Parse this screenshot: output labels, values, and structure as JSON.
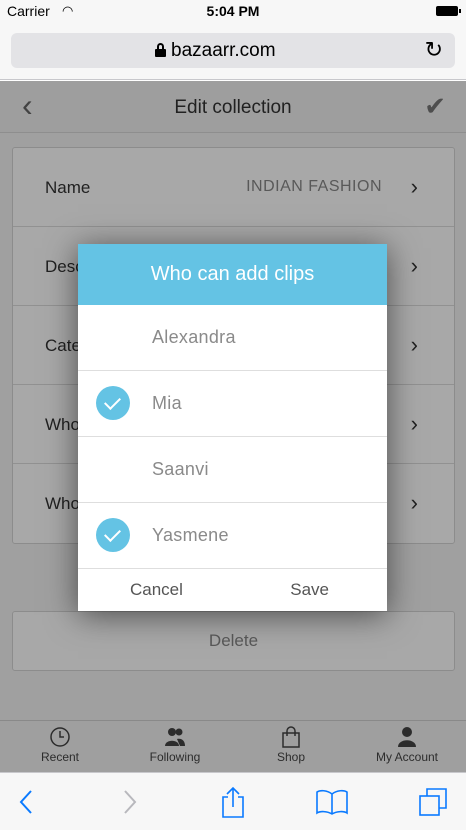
{
  "status_bar": {
    "carrier": "Carrier",
    "time": "5:04 PM"
  },
  "browser": {
    "host": "bazaarr.com"
  },
  "nav": {
    "title": "Edit collection"
  },
  "form": {
    "rows": [
      {
        "label": "Name",
        "value": "INDIAN FASHION"
      },
      {
        "label": "Desc",
        "value": ""
      },
      {
        "label": "Cate",
        "value": ""
      },
      {
        "label": "Who",
        "value": ""
      },
      {
        "label": "Who",
        "value": ""
      }
    ],
    "delete_label": "Delete"
  },
  "modal": {
    "title": "Who can add clips",
    "options": [
      {
        "name": "Alexandra",
        "checked": false
      },
      {
        "name": "Mia",
        "checked": true
      },
      {
        "name": "Saanvi",
        "checked": false
      },
      {
        "name": "Yasmene",
        "checked": true
      }
    ],
    "cancel_label": "Cancel",
    "save_label": "Save"
  },
  "tabs": [
    {
      "label": "Recent",
      "icon": "clock-icon"
    },
    {
      "label": "Following",
      "icon": "people-icon"
    },
    {
      "label": "Shop",
      "icon": "shopping-bag-icon"
    },
    {
      "label": "My Account",
      "icon": "person-icon"
    }
  ],
  "colors": {
    "accent": "#64c3e4",
    "safari_blue": "#0a7aff"
  }
}
